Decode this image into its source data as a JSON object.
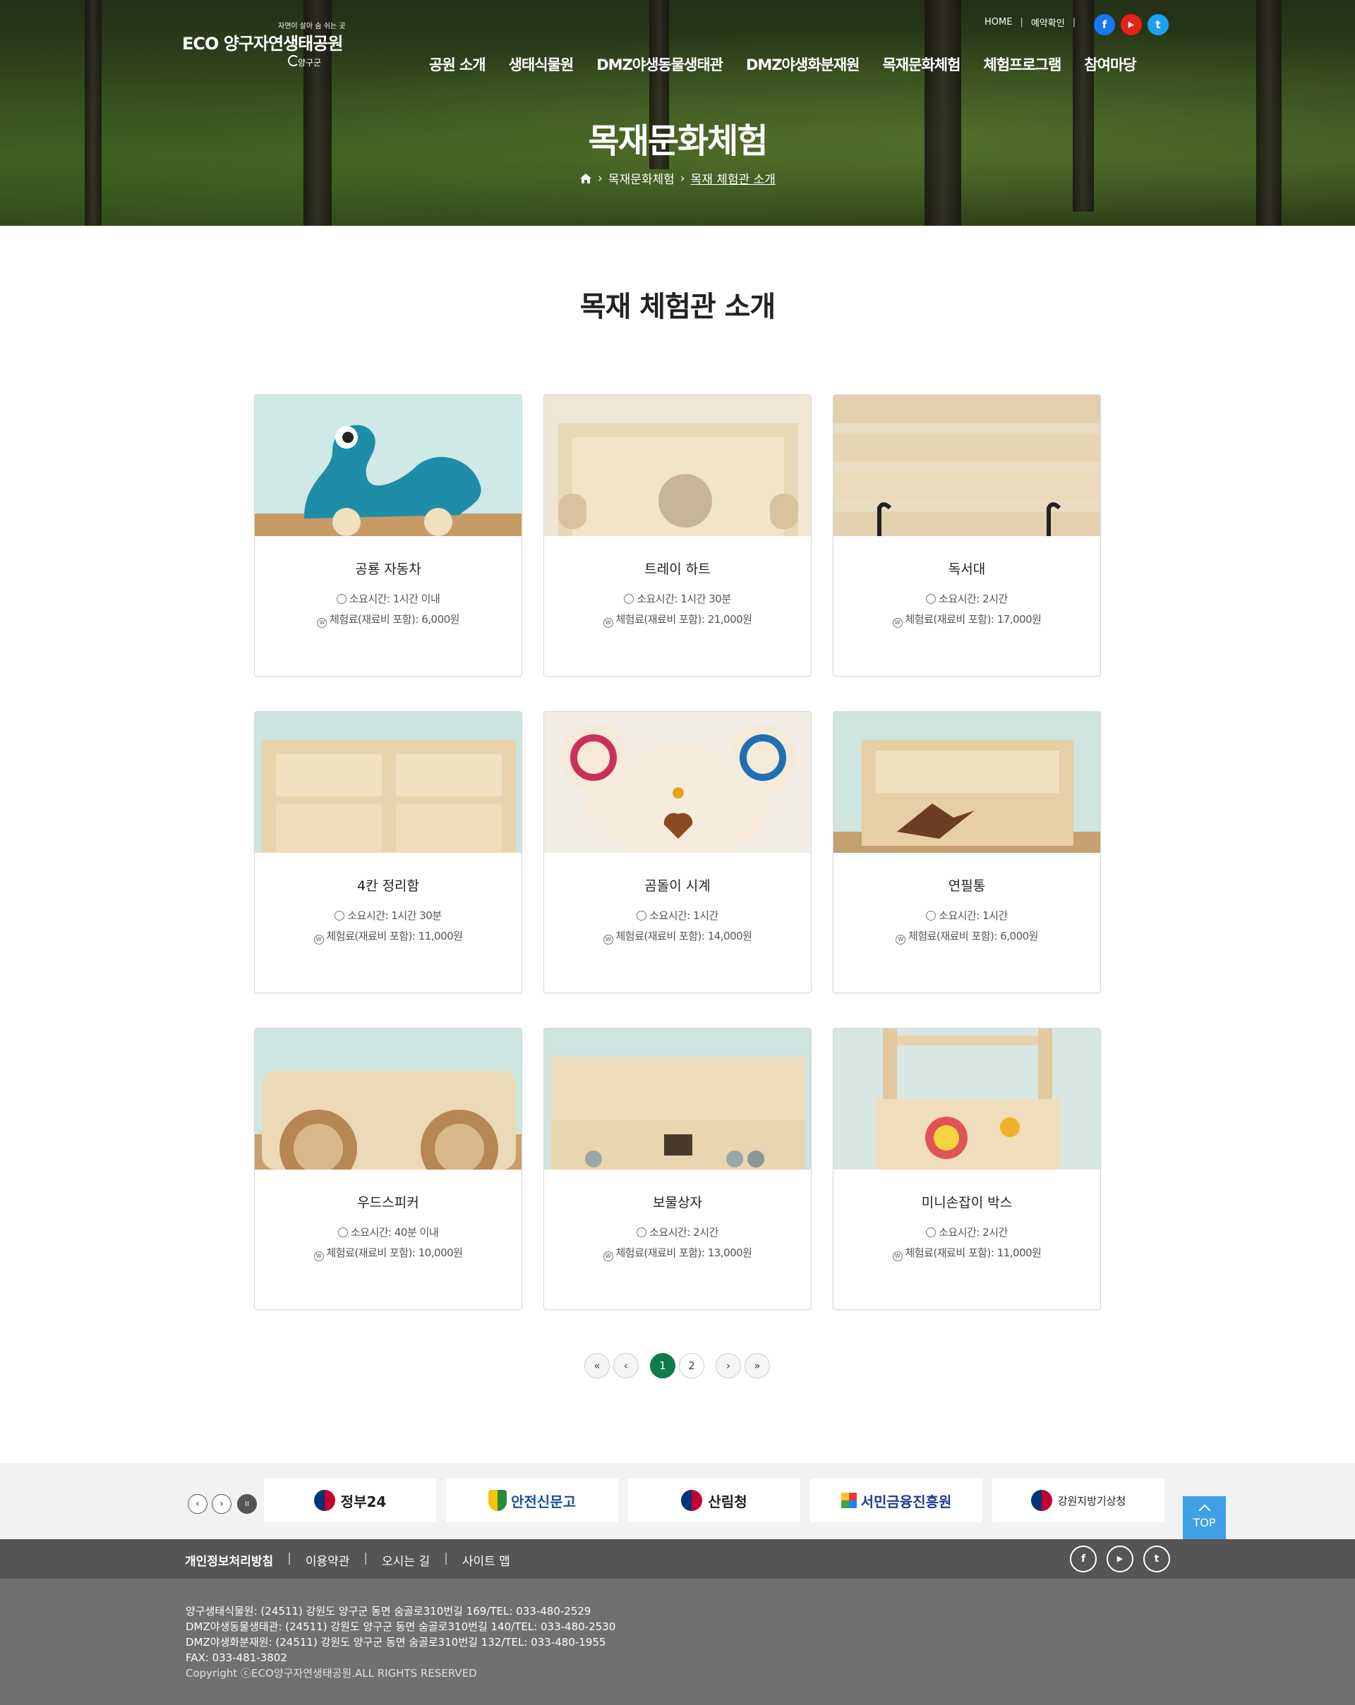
{
  "header": {
    "logo_tagline": "자연이 살아 숨 쉬는 곳",
    "logo_name": "ECO 양구자연생태공원",
    "logo_sub": "양구군",
    "util_links": [
      "HOME",
      "예약확인"
    ],
    "sns": [
      "facebook-icon",
      "youtube-icon",
      "twitter-icon"
    ],
    "sns_colors": [
      "#1877f2",
      "#e62117",
      "#1da1f2"
    ],
    "gnb": [
      "공원 소개",
      "생태식물원",
      "DMZ야생동물생태관",
      "DMZ야생화분재원",
      "목재문화체험",
      "체험프로그램",
      "참여마당"
    ]
  },
  "hero": {
    "title": "목재문화체험",
    "breadcrumb": [
      "목재문화체험",
      "목재 체험관 소개"
    ]
  },
  "section_title": "목재 체험관 소개",
  "cards": [
    {
      "title": "공룡 자동차",
      "time": "소요시간: 1시간 이내",
      "price": "체험료(재료비 포함): 6,000원"
    },
    {
      "title": "트레이 하트",
      "time": "소요시간: 1시간 30분",
      "price": "체험료(재료비 포함): 21,000원"
    },
    {
      "title": "독서대",
      "time": "소요시간: 2시간",
      "price": "체험료(재료비 포함): 17,000원"
    },
    {
      "title": "4칸 정리함",
      "time": "소요시간: 1시간 30분",
      "price": "체험료(재료비 포함): 11,000원"
    },
    {
      "title": "곰돌이 시계",
      "time": "소요시간: 1시간",
      "price": "체험료(재료비 포함): 14,000원"
    },
    {
      "title": "연필통",
      "time": "소요시간: 1시간",
      "price": "체험료(재료비 포함): 6,000원"
    },
    {
      "title": "우드스피커",
      "time": "소요시간: 40분 이내",
      "price": "체험료(재료비 포함): 10,000원"
    },
    {
      "title": "보물상자",
      "time": "소요시간: 2시간",
      "price": "체험료(재료비 포함): 13,000원"
    },
    {
      "title": "미니손잡이 박스",
      "time": "소요시간: 2시간",
      "price": "체험료(재료비 포함): 11,000원"
    }
  ],
  "pagination": {
    "first": "«",
    "prev": "‹",
    "next": "›",
    "last": "»",
    "pages": [
      "1",
      "2"
    ],
    "current": "1"
  },
  "family_sites": {
    "controls": [
      "‹",
      "›",
      "II"
    ],
    "banners": [
      "정부24",
      "안전신문고",
      "산림청",
      "서민금융진흥원",
      "강원지방기상청"
    ]
  },
  "top_button": "TOP",
  "footer": {
    "links": [
      "개인정보처리방침",
      "이용약관",
      "오시는 길",
      "사이트 맵"
    ],
    "sns": [
      "f",
      "▶",
      "t"
    ],
    "info": [
      "양구생태식물원: (24511) 강원도 양구군 동면 숨골로310번길 169/TEL: 033-480-2529",
      "DMZ야생동물생태관: (24511) 강원도 양구군 동면 숨골로310번길 140/TEL: 033-480-2530",
      "DMZ야생화분재원: (24511) 강원도 양구군 동면 숨골로310번길 132/TEL: 033-480-1955",
      "FAX: 033-481-3802"
    ],
    "copyright": "Copyright ⓒECO양구자연생태공원.ALL RIGHTS RESERVED"
  },
  "colors": {
    "accent": "#0e7a4e",
    "top_button": "#3fa0e6",
    "footer_nav": "#555555",
    "footer_info": "#707070"
  }
}
